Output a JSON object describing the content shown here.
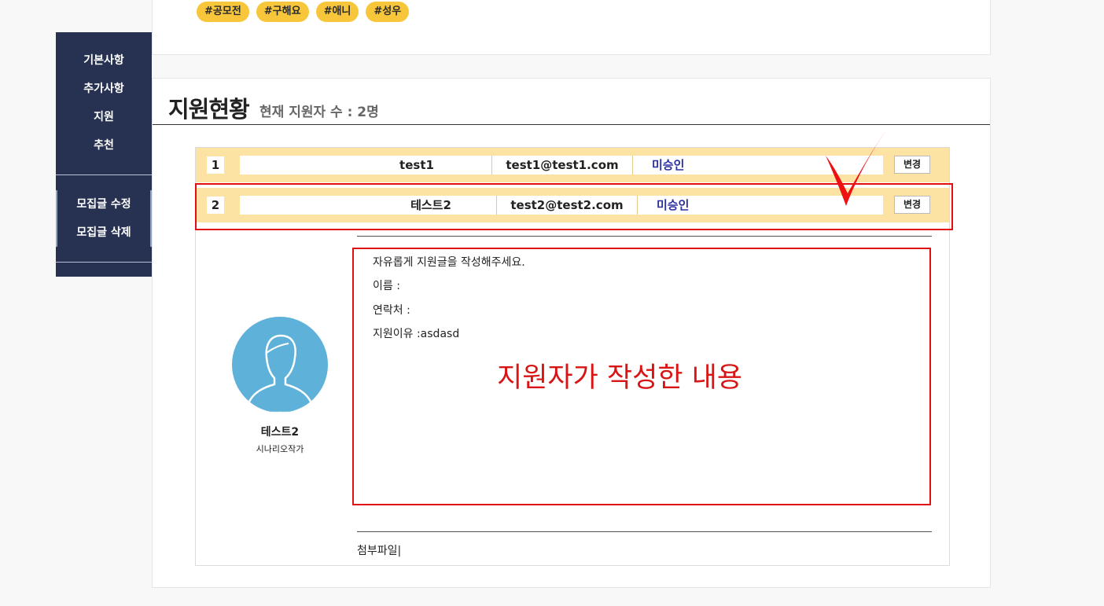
{
  "tags": [
    "#공모전",
    "#구해요",
    "#애니",
    "#성우"
  ],
  "sidebar": {
    "items": [
      "기본사항",
      "추가사항",
      "지원",
      "추천"
    ],
    "actions": [
      "모집글 수정",
      "모집글 삭제"
    ]
  },
  "section": {
    "title": "지원현황",
    "subtitle": "현재 지원자 수 : 2명"
  },
  "applicants": [
    {
      "num": "1",
      "name": "test1",
      "email": "test1@test1.com",
      "status": "미승인",
      "button": "변경"
    },
    {
      "num": "2",
      "name": "테스트2",
      "email": "test2@test2.com",
      "status": "미승인",
      "button": "변경"
    }
  ],
  "profile": {
    "name": "테스트2",
    "role": "시나리오작가"
  },
  "message": {
    "lines": [
      "자유롭게 지원글을 작성해주세요.",
      "이름 :",
      "연락처 :",
      "지원이유 :asdasd"
    ]
  },
  "annotation": {
    "text": "지원자가 작성한 내용",
    "color": "#d81414"
  },
  "attachment": {
    "label": "첨부파일|"
  },
  "colors": {
    "sidebar": "#273252",
    "tag": "#f7c63a",
    "row": "#fde3a3",
    "status": "#2a2fa0",
    "avatar": "#5eb1d9"
  }
}
